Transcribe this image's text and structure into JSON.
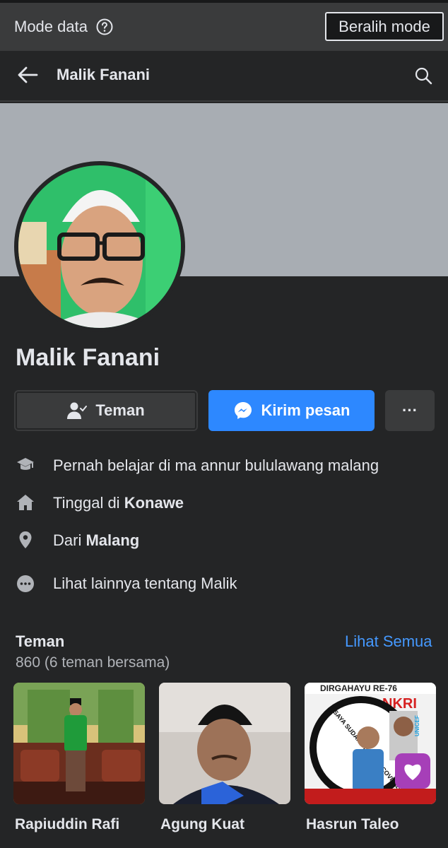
{
  "data_mode": {
    "label": "Mode data",
    "switch_label": "Beralih mode"
  },
  "header": {
    "title": "Malik Fanani"
  },
  "profile": {
    "name": "Malik Fanani"
  },
  "actions": {
    "friend_label": "Teman",
    "message_label": "Kirim pesan",
    "more_label": "···"
  },
  "info": {
    "education": "Pernah belajar di ma annur bululawang malang",
    "lives_prefix": "Tinggal di ",
    "lives_place": "Konawe",
    "from_prefix": "Dari ",
    "from_place": "Malang",
    "more_about": "Lihat lainnya tentang Malik"
  },
  "friends": {
    "title": "Teman",
    "count": "860 (6 teman bersama)",
    "see_all": "Lihat Semua",
    "items": [
      {
        "name": "Rapiuddin Rafi"
      },
      {
        "name": "Agung Kuat"
      },
      {
        "name": "Hasrun Taleo",
        "banner_top": "DIRGAHAYU RE-76",
        "banner_nkri": "NKRI",
        "banner_circle": "SAYA SUDAH DIVAKSIN COVID-19",
        "banner_unicef": "UNICEF"
      }
    ]
  },
  "colors": {
    "accent": "#2d88ff",
    "link": "#4599ff",
    "background": "#242526",
    "surface": "#3a3b3c",
    "cover": "#a8adb3"
  },
  "icons": {
    "help": "question-circle-icon",
    "back": "arrow-left-icon",
    "search": "search-icon",
    "friend": "person-check-icon",
    "messenger": "messenger-icon",
    "education": "graduation-cap-icon",
    "home": "home-icon",
    "location": "map-pin-icon",
    "more": "ellipsis-circle-icon"
  }
}
